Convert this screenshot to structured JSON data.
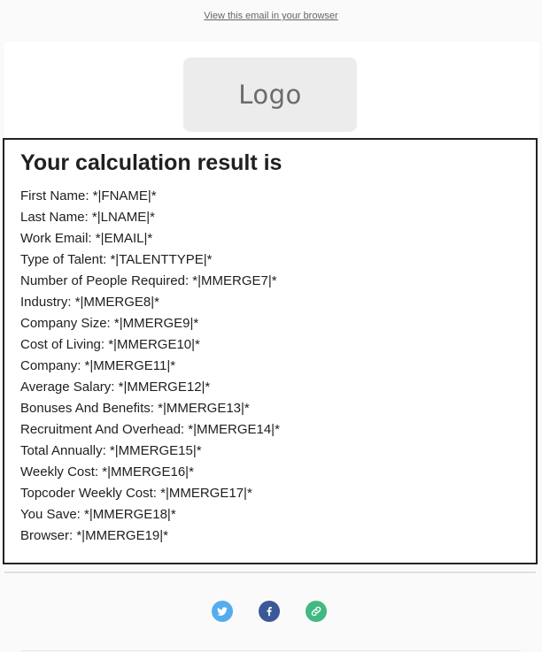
{
  "preheader": {
    "link_text": "View this email in your browser"
  },
  "header": {
    "logo_text": "Logo"
  },
  "result": {
    "title": "Your calculation result is",
    "fields": [
      "First Name: *|FNAME|*",
      "Last Name: *|LNAME|*",
      "Work Email: *|EMAIL|*",
      "Type of Talent: *|TALENTTYPE|*",
      "Number of People Required: *|MMERGE7|*",
      "Industry: *|MMERGE8|*",
      "Company Size: *|MMERGE9|*",
      "Cost of Living: *|MMERGE10|*",
      "Company: *|MMERGE11|*",
      "Average Salary: *|MMERGE12|*",
      "Bonuses And Benefits: *|MMERGE13|*",
      "Recruitment And Overhead: *|MMERGE14|*",
      "Total Annually: *|MMERGE15|*",
      "Weekly Cost: *|MMERGE16|*",
      "Topcoder Weekly Cost: *|MMERGE17|*",
      "You Save: *|MMERGE18|*",
      "Browser: *|MMERGE19|*"
    ]
  },
  "social": {
    "icons": [
      {
        "name": "twitter-icon",
        "color": "#55acee"
      },
      {
        "name": "facebook-icon",
        "color": "#3b5998"
      },
      {
        "name": "link-icon",
        "color": "#42b883"
      }
    ]
  },
  "colors": {
    "background": "#fafafa",
    "text": "#202020",
    "preheader_link": "#656565",
    "result_border": "#222222"
  }
}
